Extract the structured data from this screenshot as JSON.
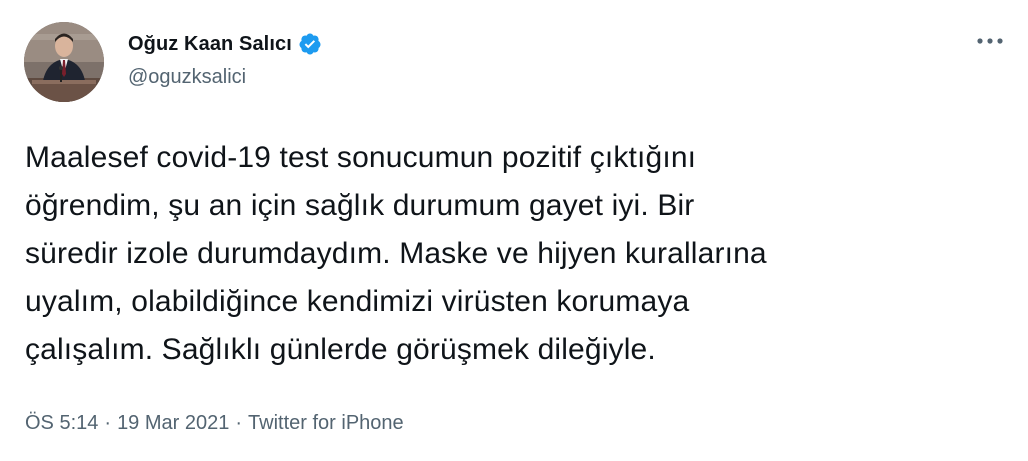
{
  "author": {
    "display_name": "Oğuz Kaan Salıcı",
    "handle": "@oguzksalici",
    "verified_icon": "verified-badge-icon",
    "verified_color": "#1d9bf0"
  },
  "tweet": {
    "text": "Maalesef covid-19 test sonucumun pozitif çıktığını\nöğrendim, şu an için sağlık durumum gayet iyi. Bir\nsüredir izole durumdaydım. Maske ve hijyen kurallarına\nuyalım, olabildiğince kendimizi virüsten korumaya\nçalışalım. Sağlıklı günlerde görüşmek dileğiyle.",
    "time": "ÖS 5:14",
    "separator": "·",
    "date": "19 Mar 2021",
    "source": "Twitter for iPhone"
  },
  "actions": {
    "more_icon": "more-options-icon"
  },
  "colors": {
    "text_primary": "#0f1419",
    "text_secondary": "#536471",
    "background": "#ffffff"
  }
}
